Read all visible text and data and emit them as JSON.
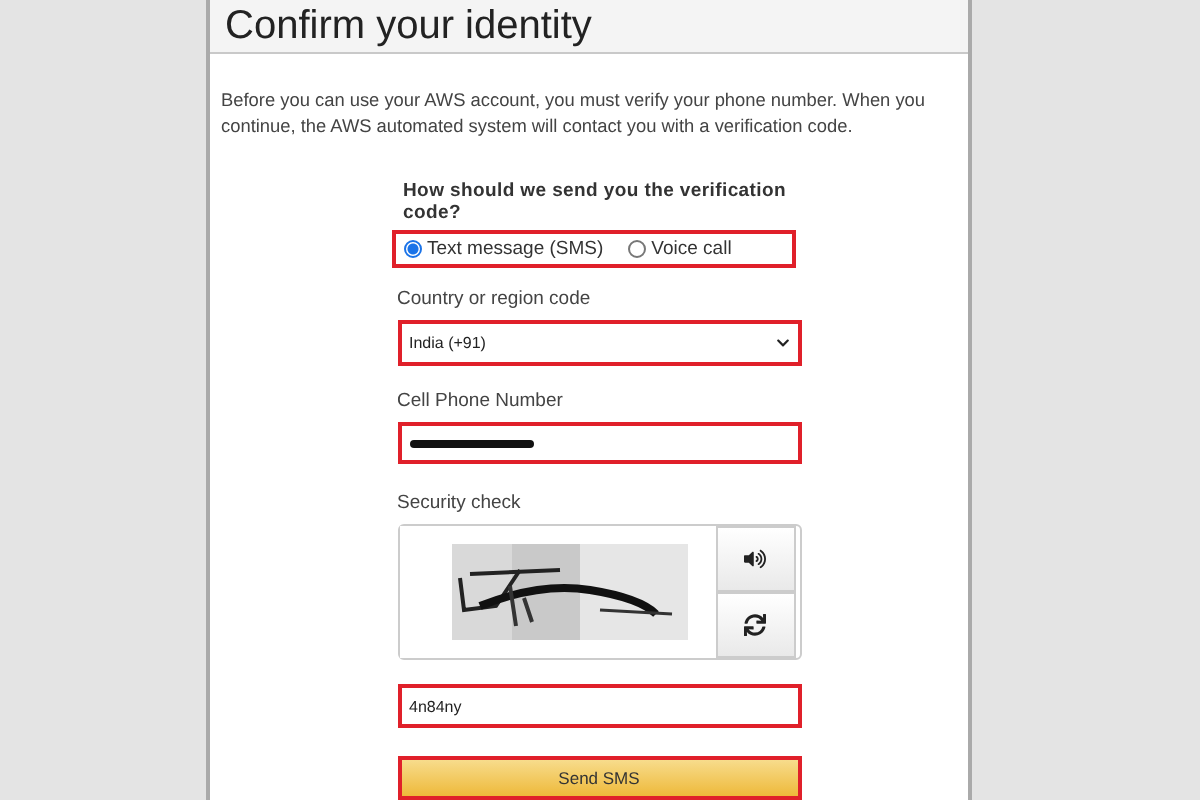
{
  "title": "Confirm your identity",
  "intro": "Before you can use your AWS account, you must verify your phone number. When you continue, the AWS automated system will contact you with a verification code.",
  "method": {
    "question": "How should we send you the verification code?",
    "highlighted": true,
    "options": [
      {
        "label": "Text message (SMS)",
        "selected": true
      },
      {
        "label": "Voice call",
        "selected": false
      }
    ]
  },
  "country": {
    "label": "Country or region code",
    "value": "India (+91)",
    "highlighted": true
  },
  "phone": {
    "label": "Cell Phone Number",
    "redacted": true,
    "highlighted": true
  },
  "security": {
    "label": "Security check",
    "value": "4n84ny",
    "highlighted": true
  },
  "submit": {
    "label": "Send SMS",
    "highlighted": true
  }
}
